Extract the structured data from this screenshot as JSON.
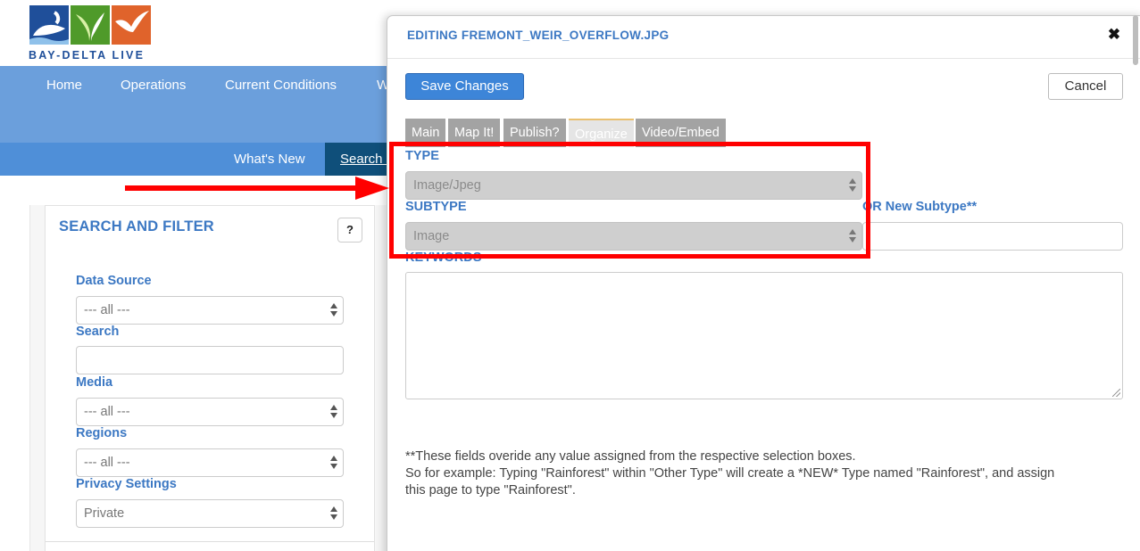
{
  "logo": {
    "text": "BAY-DELTA LIVE"
  },
  "nav": {
    "items": [
      "Home",
      "Operations",
      "Current Conditions",
      "W"
    ]
  },
  "subnav": {
    "whats_new": "What's New",
    "search": "Search &"
  },
  "sidebar": {
    "title": "SEARCH AND FILTER",
    "help_label": "?",
    "data_source": {
      "label": "Data Source",
      "value": "--- all ---"
    },
    "search": {
      "label": "Search",
      "value": ""
    },
    "media": {
      "label": "Media",
      "value": "--- all ---"
    },
    "regions": {
      "label": "Regions",
      "value": "--- all ---"
    },
    "privacy": {
      "label": "Privacy Settings",
      "value": "Private"
    }
  },
  "modal": {
    "title": "EDITING FREMONT_WEIR_OVERFLOW.JPG",
    "close_icon": "close-icon",
    "save_label": "Save Changes",
    "cancel_label": "Cancel",
    "tabs": [
      {
        "label": "Main",
        "active": false
      },
      {
        "label": "Map It!",
        "active": false
      },
      {
        "label": "Publish?",
        "active": false
      },
      {
        "label": "Organize",
        "active": true
      },
      {
        "label": "Video/Embed",
        "active": false
      }
    ],
    "type": {
      "label": "TYPE",
      "value": "Image/Jpeg"
    },
    "subtype": {
      "label": "SUBTYPE",
      "value": "Image"
    },
    "new_subtype": {
      "label": "OR New Subtype**",
      "value": ""
    },
    "keywords": {
      "label": "KEYWORDS",
      "value": ""
    },
    "note_line1": "**These fields overide any value assigned from the respective selection boxes.",
    "note_line2": "So for example: Typing \"Rainforest\" within \"Other Type\" will create a *NEW* Type named \"Rainforest\", and assign",
    "note_line3": "this page to type \"Rainforest\"."
  },
  "colors": {
    "accent": "#3c78c3",
    "nav_bg": "#6b9fdc",
    "subnav_bg": "#4f8fd8",
    "highlight": "#ff0000"
  }
}
